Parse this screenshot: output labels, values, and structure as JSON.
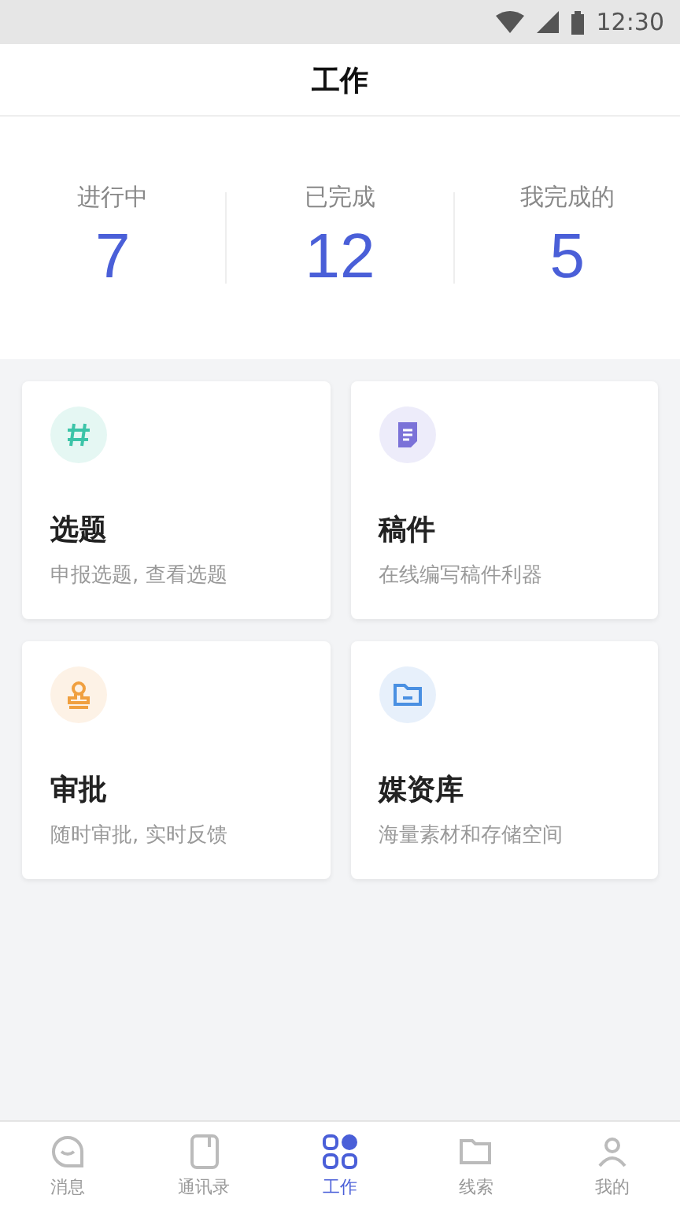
{
  "status_bar": {
    "time": "12:30"
  },
  "header": {
    "title": "工作"
  },
  "stats": [
    {
      "label": "进行中",
      "value": "7"
    },
    {
      "label": "已完成",
      "value": "12"
    },
    {
      "label": "我完成的",
      "value": "5"
    }
  ],
  "cards": [
    {
      "kind": "hash",
      "color": "#3cc4a8",
      "title": "选题",
      "subtitle": "申报选题, 查看选题"
    },
    {
      "kind": "document",
      "color": "#7b72d8",
      "title": "稿件",
      "subtitle": "在线编写稿件利器"
    },
    {
      "kind": "stamp",
      "color": "#f0a040",
      "title": "审批",
      "subtitle": "随时审批, 实时反馈"
    },
    {
      "kind": "folder",
      "color": "#4a90e2",
      "title": "媒资库",
      "subtitle": "海量素材和存储空间"
    }
  ],
  "tabs": [
    {
      "kind": "chat",
      "label": "消息",
      "selected": false
    },
    {
      "kind": "contacts",
      "label": "通讯录",
      "selected": false
    },
    {
      "kind": "grid",
      "label": "工作",
      "selected": true
    },
    {
      "kind": "clues",
      "label": "线索",
      "selected": false
    },
    {
      "kind": "person",
      "label": "我的",
      "selected": false
    }
  ]
}
